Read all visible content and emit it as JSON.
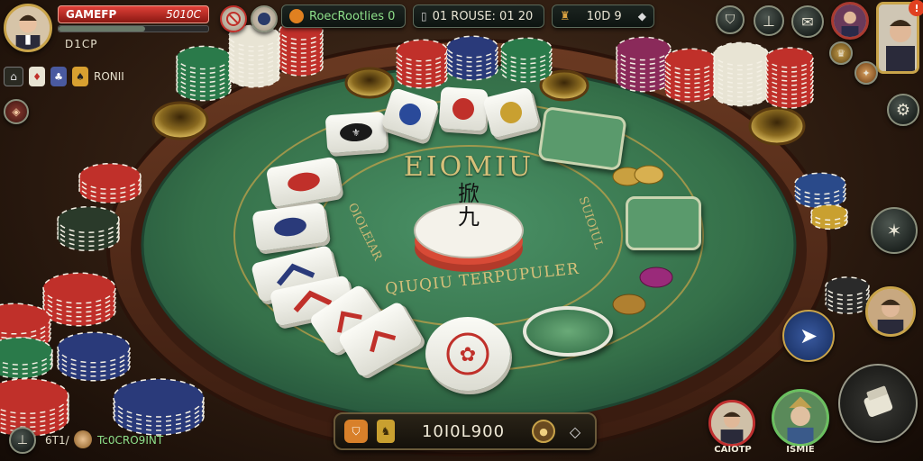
{
  "hud": {
    "player_name": "GAMEFP",
    "player_score": "5010C",
    "player_sub": "D1CP",
    "notices": "RoecRootlies 0",
    "center_value": "01 ROUSE: 01 20",
    "right_value": "10D 9",
    "chip_label": "RONII",
    "bottom_left_code": "6T1/",
    "bottom_left_text": "Tc0CRO9INT",
    "pot_value": "10I0L900",
    "avatar_caption_1": "CAIOTP",
    "avatar_caption_2": "ISMIE"
  },
  "table": {
    "title_arc": "EIOMIU",
    "bottom_arc": "QIUQIU TERPUPULER",
    "side_left": "OIOLEIAR",
    "side_right": "SUIOIUL",
    "center_tile_glyph": "掀\n九"
  },
  "colors": {
    "felt": "#3b7a52",
    "felt_dark": "#2a5c3c",
    "rail": "#5a2e1c",
    "gold": "#c9a44a",
    "hud_red": "#c0302a"
  },
  "icons": [
    "settings-gear-icon",
    "plane-icon",
    "bell-icon",
    "chat-icon",
    "coin-icon",
    "chevron-icon",
    "lock-icon",
    "shield-icon"
  ]
}
